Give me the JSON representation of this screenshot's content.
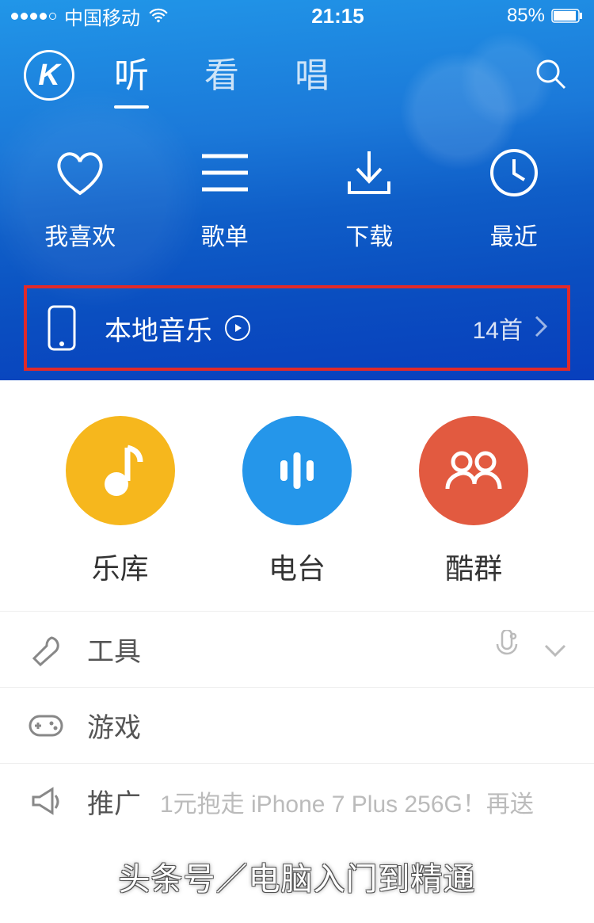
{
  "status": {
    "carrier": "中国移动",
    "time": "21:15",
    "battery": "85%"
  },
  "nav": {
    "tabs": [
      "听",
      "看",
      "唱"
    ],
    "activeIndex": 0
  },
  "quick": [
    {
      "icon": "heart-icon",
      "label": "我喜欢"
    },
    {
      "icon": "list-icon",
      "label": "歌单"
    },
    {
      "icon": "download-icon",
      "label": "下载"
    },
    {
      "icon": "clock-icon",
      "label": "最近"
    }
  ],
  "local": {
    "title": "本地音乐",
    "count": "14首"
  },
  "categories": [
    {
      "label": "乐库",
      "color": "yellow",
      "icon": "music-note-icon"
    },
    {
      "label": "电台",
      "color": "blue",
      "icon": "radio-bars-icon"
    },
    {
      "label": "酷群",
      "color": "red",
      "icon": "group-icon"
    }
  ],
  "list": [
    {
      "icon": "wrench-icon",
      "label": "工具",
      "trail": "voice-chevron"
    },
    {
      "icon": "gamepad-icon",
      "label": "游戏",
      "trail": ""
    },
    {
      "icon": "megaphone-icon",
      "label": "推广",
      "sub": "1元抱走 iPhone 7 Plus 256G！再送"
    }
  ],
  "watermark": "头条号／电脑入门到精通"
}
